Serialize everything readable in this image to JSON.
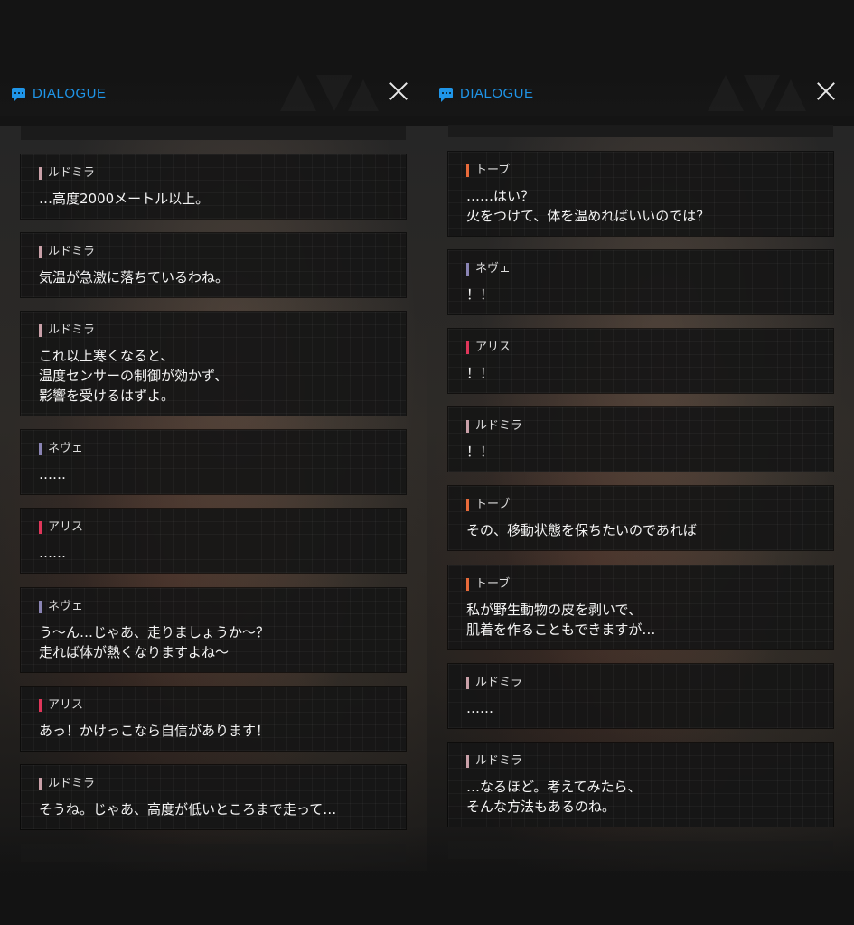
{
  "header": {
    "title": "DIALOGUE"
  },
  "colors": {
    "accent": "#1f95e8",
    "ludmila": "#c9a0a8",
    "neve": "#8a84b4",
    "alice": "#e0365a",
    "tove": "#e86a3a"
  },
  "icons": {
    "header": "chat-bubble-icon",
    "close": "close-icon"
  },
  "left_panel": {
    "messages": [
      {
        "speaker": "ルドミラ",
        "text": "…高度2000メートル以上。"
      },
      {
        "speaker": "ルドミラ",
        "text": "気温が急激に落ちているわね。"
      },
      {
        "speaker": "ルドミラ",
        "text": "これ以上寒くなると、\n温度センサーの制御が効かず、\n影響を受けるはずよ。"
      },
      {
        "speaker": "ネヴェ",
        "text": "……"
      },
      {
        "speaker": "アリス",
        "text": "……"
      },
      {
        "speaker": "ネヴェ",
        "text": "う～ん…じゃあ、走りましょうか～？\n走れば体が熱くなりますよね～"
      },
      {
        "speaker": "アリス",
        "text": "あっ！かけっこなら自信があります！"
      },
      {
        "speaker": "ルドミラ",
        "text": "そうね。じゃあ、高度が低いところまで走って…"
      }
    ]
  },
  "right_panel": {
    "messages": [
      {
        "speaker": "トーブ",
        "text": "……はい？\n火をつけて、体を温めればいいのでは？"
      },
      {
        "speaker": "ネヴェ",
        "text": "！！"
      },
      {
        "speaker": "アリス",
        "text": "！！"
      },
      {
        "speaker": "ルドミラ",
        "text": "！！"
      },
      {
        "speaker": "トーブ",
        "text": "その、移動状態を保ちたいのであれば"
      },
      {
        "speaker": "トーブ",
        "text": "私が野生動物の皮を剥いで、\n肌着を作ることもできますが…"
      },
      {
        "speaker": "ルドミラ",
        "text": "……"
      },
      {
        "speaker": "ルドミラ",
        "text": "…なるほど。考えてみたら、\nそんな方法もあるのね。"
      }
    ]
  }
}
